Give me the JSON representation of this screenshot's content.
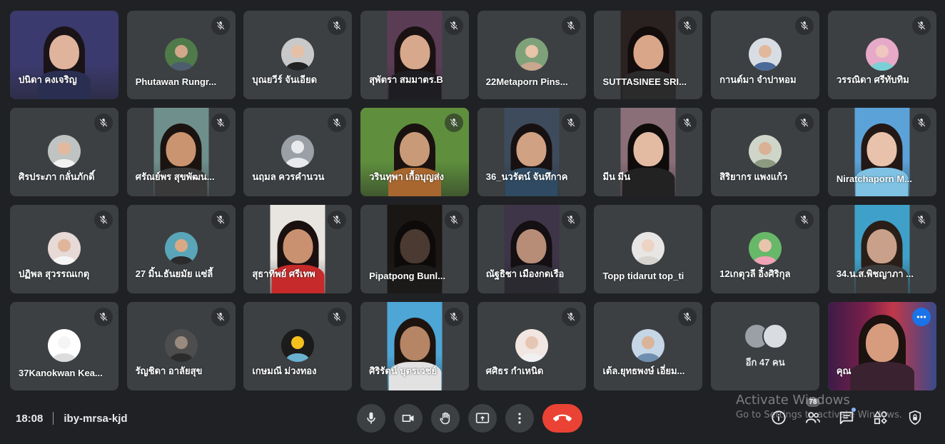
{
  "meeting": {
    "time": "18:08",
    "code": "iby-mrsa-kjd"
  },
  "participants": [
    {
      "name": "ปนิดา คงเจริญ",
      "muted": false,
      "video": "full",
      "bg": "#3b3a6e",
      "skin": "#e0b39c",
      "hair": "#1a1418",
      "shirt": "#2a2f52"
    },
    {
      "name": "Phutawan Rungr...",
      "muted": true,
      "video": "avatar",
      "bg": "#4f7a49",
      "skin": "#d3a88a",
      "shirt": "#4d5d6e"
    },
    {
      "name": "บุณยวีร์ จันเอียด",
      "muted": true,
      "video": "avatar",
      "bg": "#c9c9c9",
      "skin": "#e6c0a6",
      "shirt": "#222"
    },
    {
      "name": "สุพัตรา สมมาตร.B",
      "muted": true,
      "video": "narrow",
      "bg": "#5a3d55",
      "skin": "#d8a88c",
      "hair": "#1a1212",
      "shirt": "#1e1e22"
    },
    {
      "name": "22Metaporn Pins...",
      "muted": true,
      "video": "avatar",
      "bg": "#7fa17a",
      "skin": "#e8c4a8",
      "shirt": "#c8a78e"
    },
    {
      "name": "SUTTASINEE SRI...",
      "muted": true,
      "video": "narrow",
      "bg": "#2a2220",
      "skin": "#d9a68a",
      "hair": "#120c0c",
      "shirt": "#2b2b2b"
    },
    {
      "name": "กานต์มา จำปาหอม",
      "muted": true,
      "video": "avatar",
      "bg": "#d8dde3",
      "skin": "#e2b89c",
      "shirt": "#4a6a9a"
    },
    {
      "name": "วรรณิดา ศรีทับทิม",
      "muted": true,
      "video": "avatar",
      "bg": "#e6a9c8",
      "skin": "#f0c7c0",
      "shirt": "#7ad0d6"
    },
    {
      "name": "ศิรประภา กลั่นภักดิ์",
      "muted": true,
      "video": "avatar",
      "bg": "#bfc4c2",
      "skin": "#e3b99e",
      "shirt": "#f2f2f2"
    },
    {
      "name": "ศรัณย์พร สุขพัฒน...",
      "muted": true,
      "video": "narrow",
      "bg": "#6f8f8c",
      "skin": "#c9946f",
      "hair": "#1b1310",
      "shirt": "#3a3a3a"
    },
    {
      "name": "นฤมล ควรคำนวน",
      "muted": true,
      "video": "generic"
    },
    {
      "name": "วรินทุพา เกื้อบุญส่ง",
      "muted": true,
      "video": "full",
      "bg": "#5f8f3d",
      "skin": "#c99a78",
      "hair": "#1a1210",
      "shirt": "#a8672e"
    },
    {
      "name": "36_นวรัตน์ จันทึกาค",
      "muted": true,
      "video": "narrow",
      "bg": "#3d4b5c",
      "skin": "#d1a183",
      "hair": "#171112",
      "shirt": "#2f4a62"
    },
    {
      "name": "มีน มีน",
      "muted": true,
      "video": "narrow",
      "bg": "#8a6f78",
      "skin": "#e2bba2",
      "hair": "#0f0b0b",
      "shirt": "#222"
    },
    {
      "name": "สิริยากร แพงแก้ว",
      "muted": true,
      "video": "avatar",
      "bg": "#cfd5c8",
      "skin": "#d9b195",
      "shirt": "#8c9a80"
    },
    {
      "name": "Niratchaporn M...",
      "muted": true,
      "video": "narrow",
      "bg": "#5ba2d8",
      "skin": "#e8c2ab",
      "hair": "#231815",
      "shirt": "#7fc2e3"
    },
    {
      "name": "ปฏิพล สุวรรณเกตุ",
      "muted": true,
      "video": "avatar",
      "bg": "#e6d9d6",
      "skin": "#e0b59a",
      "shirt": "#f5f5f5"
    },
    {
      "name": "27 มิ้น.ธันยมัย แซ่ลี้",
      "muted": true,
      "video": "avatar",
      "bg": "#5aa6b8",
      "skin": "#d9a884",
      "shirt": "#2b2b2b"
    },
    {
      "name": "สุธาทิพย์ ศรีเทพ",
      "muted": true,
      "video": "narrow",
      "bg": "#e8e4df",
      "skin": "#c9916f",
      "hair": "#1a1010",
      "shirt": "#c62a2a"
    },
    {
      "name": "Pipatpong Bunl...",
      "muted": true,
      "video": "narrow",
      "bg": "#1a1614",
      "skin": "#4a3a32",
      "hair": "#0d0a09",
      "shirt": "#1c1a19"
    },
    {
      "name": "ณัฐธิชา เมืองกดเรือ",
      "muted": true,
      "video": "narrow",
      "bg": "#3e3548",
      "skin": "#b88d78",
      "hair": "#140f12",
      "shirt": "#2a2a30"
    },
    {
      "name": "Topp tidarut top_ti",
      "muted": false,
      "video": "avatar",
      "bg": "#e8e6e4",
      "skin": "#ecd3c4",
      "shirt": "#d7d3cf"
    },
    {
      "name": "12เกตุวลี อิ้งศิริกุล",
      "muted": true,
      "video": "avatar",
      "bg": "#68b86a",
      "skin": "#e9c4ad",
      "shirt": "#f2a2b5"
    },
    {
      "name": "34.น.ส.พิชญาภา ...",
      "muted": true,
      "video": "narrow",
      "bg": "#3fa1c9",
      "skin": "#c9a089",
      "hair": "#2a1e19",
      "shirt": "#3b3b3b"
    },
    {
      "name": "37Kanokwan Kea...",
      "muted": true,
      "video": "avatar",
      "bg": "#ffffff",
      "skin": "#f5f5f5",
      "shirt": "#dcdcdc"
    },
    {
      "name": "รัญชิดา อาลัยสุข",
      "muted": true,
      "video": "avatar",
      "bg": "#4d4d4d",
      "skin": "#9a8a7e",
      "shirt": "#2c2c2c"
    },
    {
      "name": "เกษมณี ม่วงทอง",
      "muted": true,
      "video": "avatar",
      "bg": "#1b1b1b",
      "skin": "#f4c01e",
      "shirt": "#6ab0d0"
    },
    {
      "name": "ศิริรัตน์ บุตรเวชย์",
      "muted": true,
      "video": "narrow",
      "bg": "#4ea6d6",
      "skin": "#b58566",
      "hair": "#1d1410",
      "shirt": "#e2e2e2"
    },
    {
      "name": "ศศิธร กำเหนิด",
      "muted": true,
      "video": "avatar",
      "bg": "#f1e6e1",
      "skin": "#e6c6b3",
      "shirt": "#f0f0f0"
    },
    {
      "name": "เต้ล.ยุทธพงษ์ เอี่ยม...",
      "muted": true,
      "video": "avatar",
      "bg": "#c5d6e6",
      "skin": "#dab49a",
      "shirt": "#6f8fb0"
    }
  ],
  "others": {
    "label": "อีก 47 คน"
  },
  "self": {
    "name": "คุณ",
    "bg": "#7a1f4a",
    "skin": "#d69c7d",
    "hair": "#1c1210",
    "shirt": "#3a2230"
  },
  "controls": {
    "participants_count": "78"
  },
  "watermark": {
    "line1": "Activate Windows",
    "line2": "Go to Settings to activate Windows."
  },
  "colors": {
    "background": "#202124",
    "tile": "#3c4043",
    "end_call": "#ea4335",
    "accent": "#1a73e8"
  }
}
